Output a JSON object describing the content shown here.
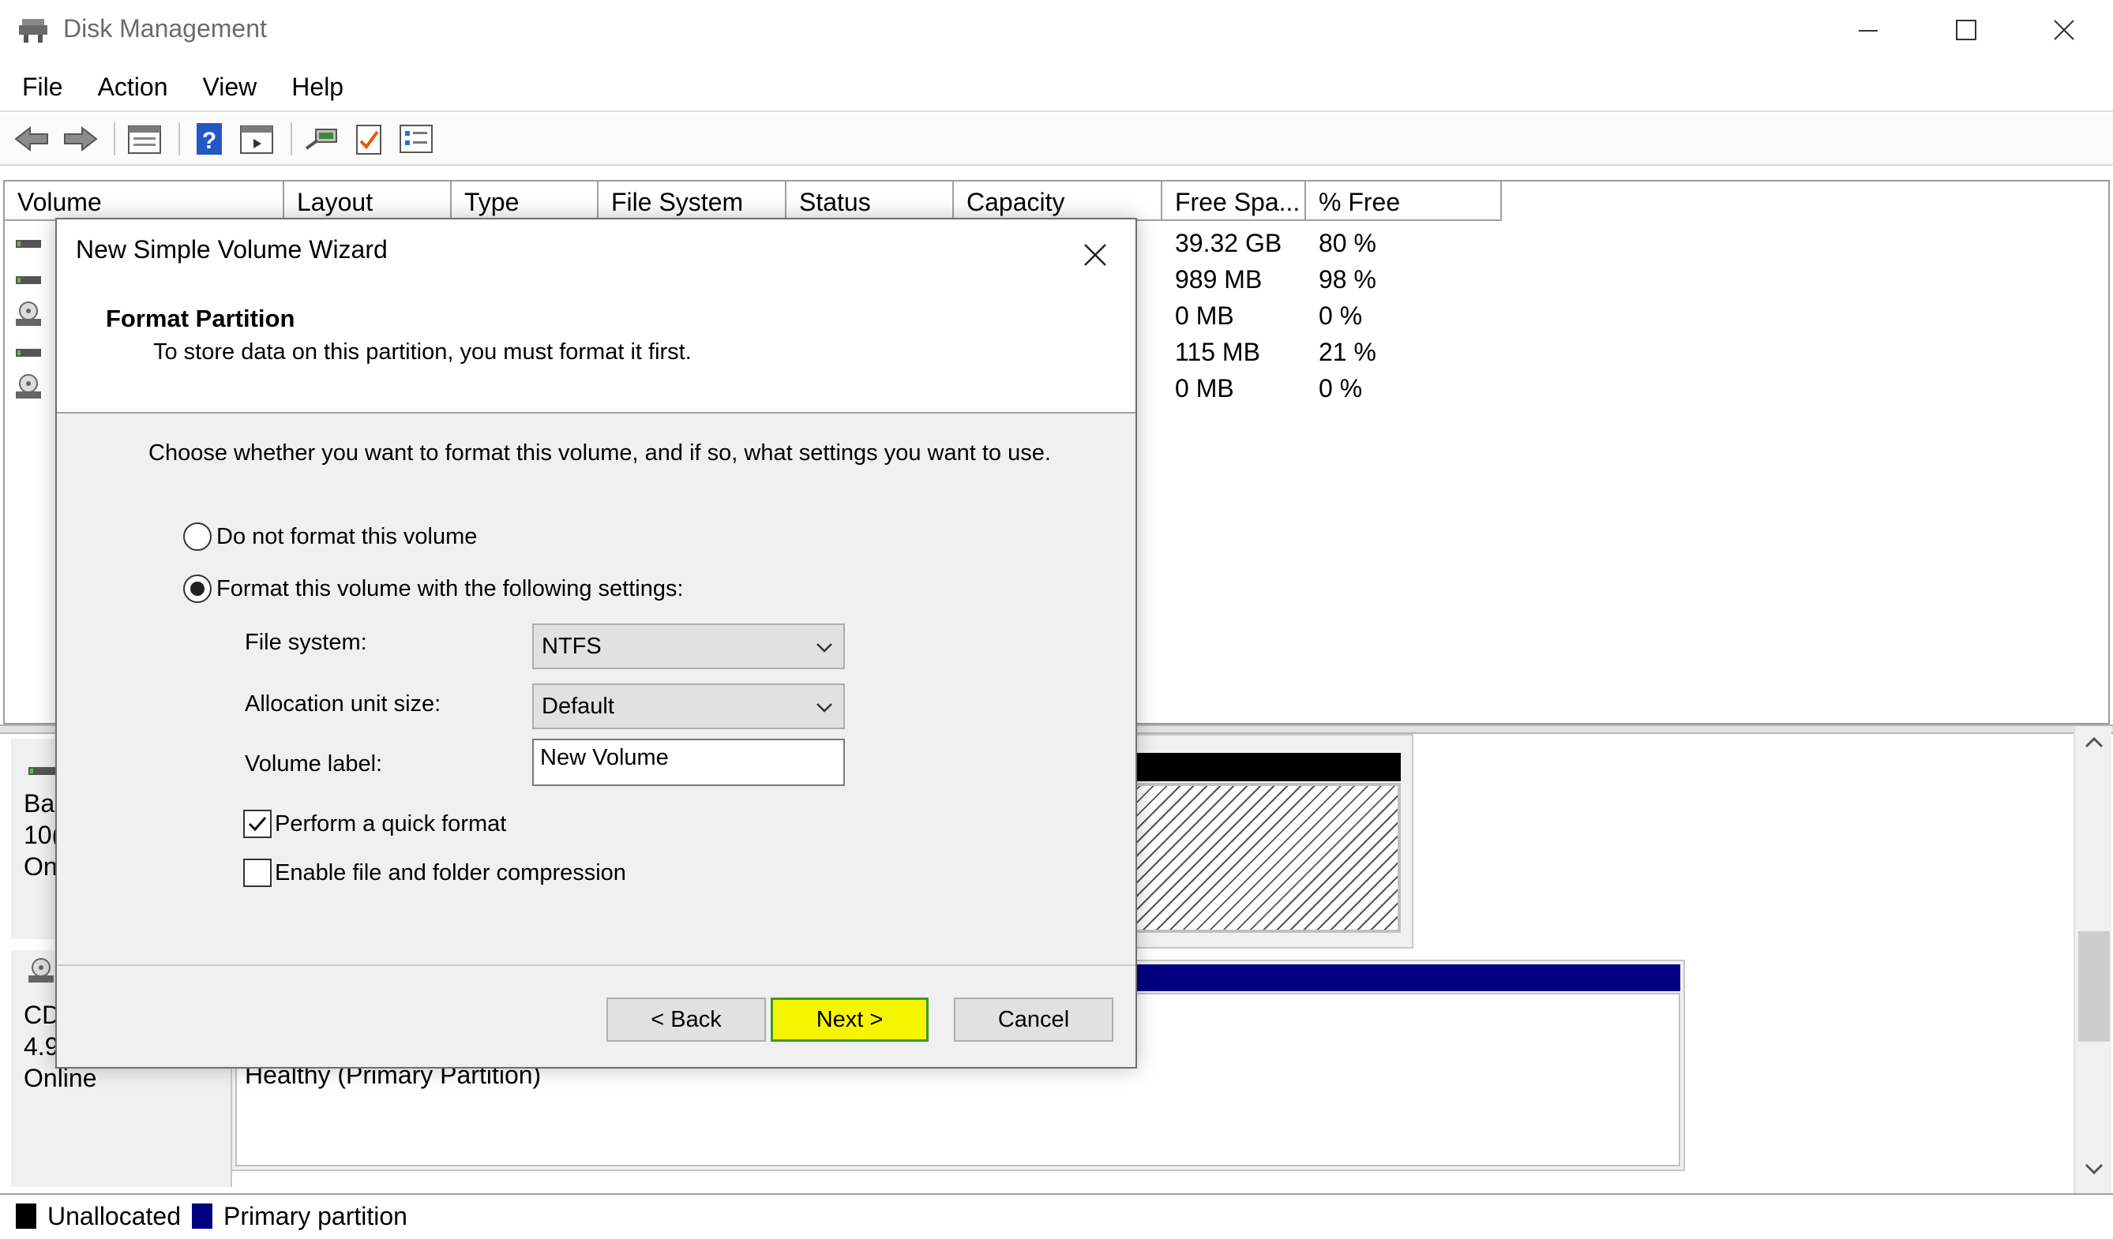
{
  "window": {
    "title": "Disk Management",
    "controls": [
      "minimize",
      "maximize",
      "close"
    ]
  },
  "menu": [
    "File",
    "Action",
    "View",
    "Help"
  ],
  "toolbar": {
    "icons": [
      "back-icon",
      "forward-icon",
      "properties-icon",
      "help-icon",
      "show-hide-icon",
      "connect-icon",
      "check-icon",
      "list-icon"
    ]
  },
  "volume_list": {
    "columns": [
      "Volume",
      "Layout",
      "Type",
      "File System",
      "Status",
      "Capacity",
      "Free Spa...",
      "% Free"
    ],
    "rows": [
      {
        "free_space": "39.32 GB",
        "pct_free": "80 %"
      },
      {
        "free_space": "989 MB",
        "pct_free": "98 %"
      },
      {
        "free_space": "0 MB",
        "pct_free": "0 %"
      },
      {
        "free_space": "115 MB",
        "pct_free": "21 %"
      },
      {
        "free_space": "0 MB",
        "pct_free": "0 %"
      }
    ]
  },
  "graphical": {
    "disk0": {
      "line1": "Ba",
      "line2": "10(",
      "line3": "On"
    },
    "cd": {
      "line1": "CD",
      "line2": "4.9",
      "line3": "Online",
      "partition_status": "Healthy (Primary Partition)"
    }
  },
  "legend": [
    {
      "label": "Unallocated",
      "color": "#000000"
    },
    {
      "label": "Primary partition",
      "color": "#000080"
    }
  ],
  "dialog": {
    "title": "New Simple Volume Wizard",
    "heading": "Format Partition",
    "subheading": "To store data on this partition, you must format it first.",
    "instruction": "Choose whether you want to format this volume, and if so, what settings you want to use.",
    "radio_no_format": "Do not format this volume",
    "radio_format": "Format this volume with the following settings:",
    "file_system_label": "File system:",
    "file_system_value": "NTFS",
    "alloc_label": "Allocation unit size:",
    "alloc_value": "Default",
    "volume_label_label": "Volume label:",
    "volume_label_value": "New Volume",
    "quick_format": "Perform a quick format",
    "compression": "Enable file and folder compression",
    "back": "< Back",
    "next": "Next >",
    "cancel": "Cancel"
  }
}
